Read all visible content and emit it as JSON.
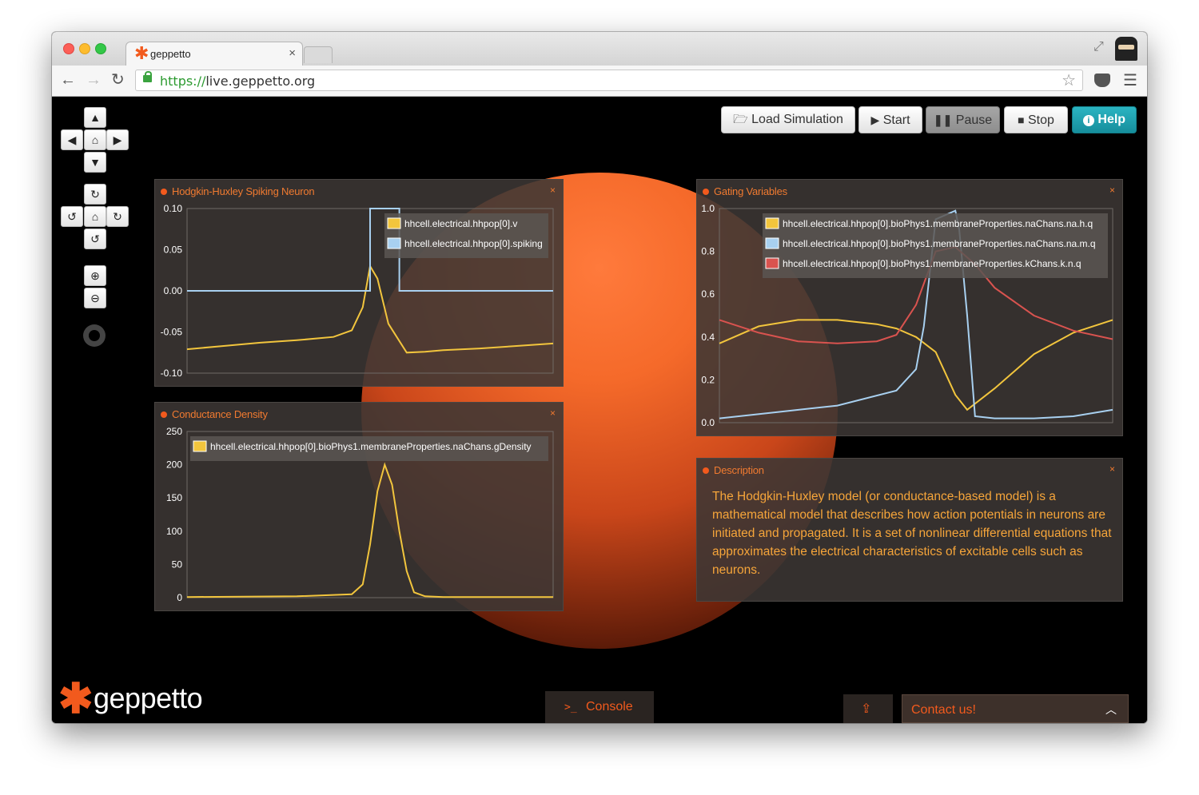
{
  "browser": {
    "tab_title": "geppetto",
    "tab_close": "×",
    "url_scheme": "https://",
    "url_host": "live.geppetto.org",
    "back_icon": "back-arrow-icon",
    "forward_icon": "forward-arrow-icon",
    "reload_icon": "reload-icon"
  },
  "toolbar": {
    "load_label": "Load Simulation",
    "start_label": "Start",
    "pause_label": "Pause",
    "stop_label": "Stop",
    "help_label": "Help"
  },
  "colors": {
    "accent_orange": "#f25a1d",
    "help_teal": "#1fa3b0",
    "series_yellow": "#f2c53d",
    "series_blue": "#a8d0f0",
    "series_red": "#d9534f"
  },
  "widgets": {
    "hh": {
      "title": "Hodgkin-Huxley Spiking Neuron",
      "close": "×"
    },
    "gating": {
      "title": "Gating Variables",
      "close": "×"
    },
    "conductance": {
      "title": "Conductance Density",
      "close": "×"
    },
    "description": {
      "title": "Description",
      "close": "×",
      "text": "The Hodgkin-Huxley model (or conductance-based model) is a mathematical model that describes how action potentials in neurons are initiated and propagated. It is a set of nonlinear differential equations that approximates the electrical characteristics of excitable cells such as neurons."
    }
  },
  "footer": {
    "logo_text": "geppetto",
    "console_label": "Console",
    "console_prompt": ">_",
    "contact_label": "Contact us!"
  },
  "chart_data": [
    {
      "type": "line",
      "yticks": [
        "0.10",
        "0.05",
        "0.00",
        "-0.05",
        "-0.10"
      ],
      "ylim": [
        -0.1,
        0.1
      ],
      "grid": false,
      "legend_placement": "top-right",
      "series": [
        {
          "name": "hhcell.electrical.hhpop[0].v",
          "color": "#f2c53d",
          "x": [
            0,
            0.1,
            0.2,
            0.3,
            0.4,
            0.45,
            0.48,
            0.5,
            0.52,
            0.55,
            0.6,
            0.65,
            0.7,
            0.8,
            0.9,
            1.0
          ],
          "y": [
            -0.071,
            -0.067,
            -0.063,
            -0.06,
            -0.056,
            -0.048,
            -0.02,
            0.03,
            0.015,
            -0.04,
            -0.075,
            -0.074,
            -0.072,
            -0.07,
            -0.067,
            -0.064
          ]
        },
        {
          "name": "hhcell.electrical.hhpop[0].spiking",
          "color": "#a8d0f0",
          "x": [
            0,
            0.5,
            0.5,
            0.58,
            0.58,
            1.0
          ],
          "y": [
            0,
            0,
            0.1,
            0.1,
            0,
            0
          ]
        }
      ]
    },
    {
      "type": "line",
      "yticks": [
        "1.0",
        "0.8",
        "0.6",
        "0.4",
        "0.2",
        "0.0"
      ],
      "ylim": [
        0,
        1.0
      ],
      "grid": false,
      "legend_placement": "top-right",
      "series": [
        {
          "name": "hhcell.electrical.hhpop[0].bioPhys1.membraneProperties.naChans.na.h.q",
          "color": "#f2c53d",
          "x": [
            0,
            0.1,
            0.2,
            0.3,
            0.4,
            0.45,
            0.5,
            0.55,
            0.6,
            0.63,
            0.7,
            0.8,
            0.9,
            1.0
          ],
          "y": [
            0.37,
            0.45,
            0.48,
            0.48,
            0.46,
            0.44,
            0.4,
            0.33,
            0.13,
            0.06,
            0.16,
            0.32,
            0.42,
            0.48
          ]
        },
        {
          "name": "hhcell.electrical.hhpop[0].bioPhys1.membraneProperties.naChans.na.m.q",
          "color": "#a8d0f0",
          "x": [
            0,
            0.15,
            0.3,
            0.45,
            0.5,
            0.52,
            0.55,
            0.6,
            0.61,
            0.63,
            0.65,
            0.7,
            0.8,
            0.9,
            1.0
          ],
          "y": [
            0.02,
            0.05,
            0.08,
            0.15,
            0.25,
            0.45,
            0.95,
            0.99,
            0.9,
            0.5,
            0.03,
            0.02,
            0.02,
            0.03,
            0.06
          ]
        },
        {
          "name": "hhcell.electrical.hhpop[0].bioPhys1.membraneProperties.kChans.k.n.q",
          "color": "#d9534f",
          "x": [
            0,
            0.1,
            0.2,
            0.3,
            0.4,
            0.45,
            0.5,
            0.55,
            0.6,
            0.65,
            0.7,
            0.8,
            0.9,
            1.0
          ],
          "y": [
            0.48,
            0.42,
            0.38,
            0.37,
            0.38,
            0.41,
            0.55,
            0.8,
            0.82,
            0.74,
            0.63,
            0.5,
            0.43,
            0.39
          ]
        }
      ]
    },
    {
      "type": "line",
      "yticks": [
        "250",
        "200",
        "150",
        "100",
        "50",
        "0"
      ],
      "ylim": [
        0,
        250
      ],
      "grid": false,
      "legend_placement": "top-right",
      "series": [
        {
          "name": "hhcell.electrical.hhpop[0].bioPhys1.membraneProperties.naChans.gDensity",
          "color": "#f2c53d",
          "x": [
            0,
            0.3,
            0.45,
            0.48,
            0.5,
            0.52,
            0.54,
            0.56,
            0.58,
            0.6,
            0.62,
            0.65,
            0.7,
            1.0
          ],
          "y": [
            1,
            2,
            5,
            20,
            80,
            160,
            200,
            170,
            100,
            40,
            8,
            2,
            1,
            1
          ]
        }
      ]
    }
  ]
}
